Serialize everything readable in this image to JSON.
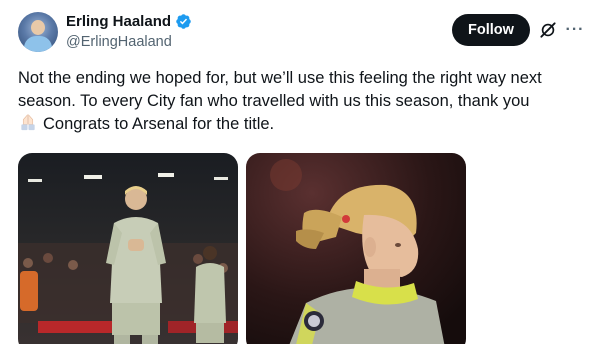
{
  "author": {
    "display_name": "Erling Haaland",
    "handle": "@ErlingHaaland",
    "verified": true,
    "avatar_icon": "profile-photo"
  },
  "actions": {
    "follow_label": "Follow",
    "grok_icon": "grok-icon",
    "more_icon": "more-icon",
    "more_glyph": "···"
  },
  "tweet": {
    "line1": "Not the ending we hoped for, but we’ll use this feeling the right way next",
    "line2": "season. To every City fan who travelled with us this season, thank you",
    "line3": "Congrats to Arsenal for the title.",
    "emoji": "folded-hands-icon"
  },
  "media": [
    {
      "name": "photo-applauding-fans",
      "icon": "photo"
    },
    {
      "name": "photo-haaland-closeup",
      "icon": "photo"
    }
  ],
  "colors": {
    "text": "#0f1419",
    "secondary": "#536471",
    "button_bg": "#0f1419",
    "verified": "#1d9bf0"
  }
}
